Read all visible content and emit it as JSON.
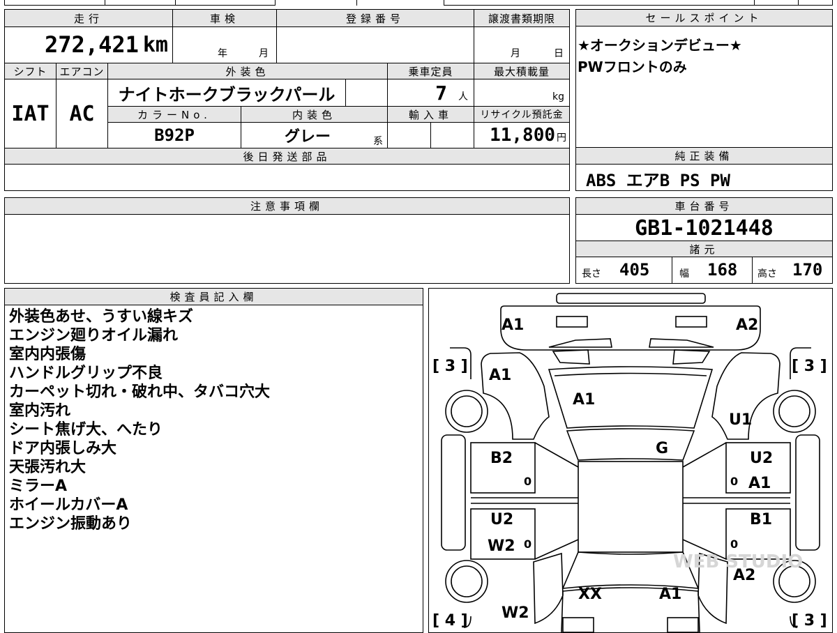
{
  "top_strip": {
    "partial_text": "■■ ■■"
  },
  "main_table": {
    "mileage": {
      "header": "走行",
      "value": "272,421",
      "unit": "km"
    },
    "inspection": {
      "header": "車検",
      "year": "年",
      "month": "月"
    },
    "registration": {
      "header": "登録番号",
      "value": ""
    },
    "transfer_deadline": {
      "header": "譲渡書類期限",
      "month": "月",
      "day": "日"
    },
    "shift": {
      "header": "シフト",
      "value": "IAT"
    },
    "aircon": {
      "header": "エアコン",
      "value": "AC"
    },
    "exterior_color": {
      "header": "外装色",
      "value": "ナイトホークブラックパール"
    },
    "capacity": {
      "header": "乗車定員",
      "value": "7",
      "unit": "人"
    },
    "max_load": {
      "header": "最大積載量",
      "value": "",
      "unit": "kg"
    },
    "color_no": {
      "header": "カラーNo.",
      "value": "B92P"
    },
    "interior_color": {
      "header": "内装色",
      "value": "グレー",
      "suffix": "系"
    },
    "import": {
      "header": "輸入車",
      "value": ""
    },
    "recycle_fee": {
      "header": "リサイクル預託金",
      "value": "11,800",
      "unit": "円"
    },
    "later_parts": {
      "header": "後日発送部品",
      "value": ""
    }
  },
  "sales_points": {
    "header": "セールスポイント",
    "lines": [
      "★オークションデビュー★",
      "PWフロントのみ"
    ]
  },
  "genuine_equipment": {
    "header": "純正装備",
    "value": "ABS エアB PS PW"
  },
  "notes": {
    "header": "注意事項欄",
    "value": ""
  },
  "chassis": {
    "header": "車台番号",
    "value": "GB1-1021448"
  },
  "specs": {
    "header": "諸元",
    "length": {
      "label": "長さ",
      "value": "405"
    },
    "width": {
      "label": "幅",
      "value": "168"
    },
    "height": {
      "label": "高さ",
      "value": "170"
    }
  },
  "inspector": {
    "header": "検査員記入欄",
    "lines": [
      "外装色あせ、うすい線キズ",
      "エンジン廻りオイル漏れ",
      "室内内張傷",
      "ハンドルグリップ不良",
      "カーペット切れ・破れ中、タバコ穴大",
      "室内汚れ",
      "シート焦げ大、へたり",
      "ドア内張しみ大",
      "天張汚れ大",
      "ミラーA",
      "ホイールカバーA",
      "エンジン振動あり"
    ]
  },
  "diagram": {
    "tires": {
      "front_left": "[ 3 ]",
      "front_right": "[ 3 ]",
      "rear_left": "[ 4 ]",
      "rear_right": "[ 3 ]"
    },
    "marks": {
      "bumper_left": "A1",
      "bumper_right": "A2",
      "fender_front_left": "A1",
      "hood": "A1",
      "fender_front_right": "U1",
      "windshield": "G",
      "front_door_left": "B2",
      "front_door_right_1": "U2",
      "front_door_right_2": "A1",
      "rear_door_left_1": "U2",
      "rear_door_left_2": "W2",
      "rear_door_right": "B1",
      "quarter_right": "A2",
      "rear_left": "W2",
      "rear_center": "XX",
      "rear_right": "A1",
      "zero": "0"
    },
    "watermark": "WEB STUDIO"
  }
}
